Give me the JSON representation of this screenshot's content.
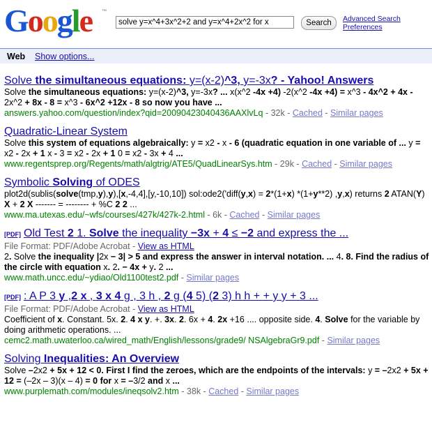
{
  "logo": {
    "letters": [
      "G",
      "o",
      "o",
      "g",
      "l",
      "e"
    ],
    "tm": "™"
  },
  "search": {
    "query": "solve y=x^4+3x^2+2 and y=x^4+2x^2 for x",
    "button": "Search",
    "advanced": "Advanced Search",
    "preferences": "Preferences"
  },
  "bar": {
    "web": "Web",
    "options": "Show options..."
  },
  "results": [
    {
      "title": [
        "Solve",
        " the simultaneous equations: ",
        "y=(x-2)",
        "^3, ",
        "y=-3x",
        "? - Yahoo! Answers"
      ],
      "snippet": [
        "Solve",
        " the simultaneous equations: ",
        "y=(x-2)",
        "^3, ",
        "y=-3x",
        "? ... ",
        "x(x^2",
        " -4x +4) ",
        "-2(x^2",
        " -4x +4) = ",
        "x^3",
        " - 4x^2 + 4x - ",
        "2x^2",
        " + 8x - 8 = ",
        "x^3",
        " - 6x^2 +12x - 8 so now you have ..."
      ],
      "url": "answers.yahoo.com/question/index?qid=20090423040436AAXlvLq",
      "size": " - 32k - ",
      "cached": "Cached",
      "similar": "Similar pages"
    },
    {
      "title": "Quadratic-Linear System",
      "snippet": [
        "Solve",
        " this system of equations algebraically: ",
        "y",
        " = ",
        "x2",
        " - ",
        "x",
        " - 6 (quadratic equation in one variable of ... ",
        "y",
        " = ",
        "x2",
        " - ",
        "2x",
        " + 1 ",
        "x",
        " - ",
        "3",
        " = ",
        "x2",
        " - ",
        "2x",
        " + 1 ",
        "0",
        " = ",
        "x2",
        " - ",
        "3x",
        " + ",
        "4",
        " ..."
      ],
      "url": "www.regentsprep.org/Regents/math/algtrig/ATE5/QuadLinearSys.htm",
      "size": " - 29k - ",
      "cached": "Cached",
      "similar": "Similar pages"
    },
    {
      "title": [
        "Symbolic ",
        "Solving",
        " of ODES"
      ],
      "snippet": [
        "plot2d(sublis(",
        "solve",
        "(tmp,",
        "y",
        "),",
        "y",
        "),[",
        "x",
        ",-4,4],[y,-10,10]) sol:ode2('diff(",
        "y",
        ",",
        "x",
        ") = ",
        "2",
        "*(1+",
        "x",
        ") *(1+",
        "y",
        "**2) ,",
        "y",
        ",",
        "x",
        ") returns ",
        "2",
        " ATAN(",
        "Y",
        ") ",
        "X",
        " + ",
        "2",
        " ",
        "X",
        " ------- = -------- + %C ",
        "2",
        " ",
        "2",
        " ..."
      ],
      "url": "www.ma.utexas.edu/~wfs/courses/427k/427k-2.html",
      "size": " - 6k - ",
      "cached": "Cached",
      "similar": "Similar pages"
    },
    {
      "pdf": "[PDF]",
      "title": [
        "Old Test ",
        "2",
        " 1. ",
        "Solve",
        " the inequality ",
        "−3x",
        " + ",
        "4",
        " ≤ ",
        "−2",
        " and express the ..."
      ],
      "format": "File Format: PDF/Adobe Acrobat - ",
      "view_html": "View as HTML",
      "snippet": [
        "2",
        ". ",
        "Solve",
        " the inequality |",
        "2x",
        " − 3| > 5 and express the answer in interval notation. ... ",
        "4",
        ". 8. Find the radius of the circle with equation ",
        "x",
        ". ",
        "2",
        ". − 4x + ",
        "y",
        ". ",
        "2",
        " ..."
      ],
      "url": "www.math.uncc.edu/~ydiao/Old1100test2.pdf",
      "size": " - ",
      "similar": "Similar pages"
    },
    {
      "pdf": "[PDF]",
      "title": [
        ": A P 3 ",
        "y",
        " ,",
        "2 x",
        " , ",
        "3 x 4",
        " g , 3 h , ",
        "2",
        " g (",
        "4",
        " 5) (",
        "2",
        " 3) h h + + y y + 3 ..."
      ],
      "format": "File Format: PDF/Adobe Acrobat - ",
      "view_html": "View as HTML",
      "snippet": [
        "Coefficient of ",
        "x",
        ". Constant. 5x. ",
        "2",
        ". ",
        "4",
        " ",
        "x",
        " ",
        "y",
        ". +. ",
        "3x",
        ". ",
        "2",
        ". 6x + ",
        "4",
        ". ",
        "2x",
        " +16 .... opposite side. ",
        "4",
        ". ",
        "Solve",
        " for the variable by doing arithmetic operations. ..."
      ],
      "url": "cemc2.math.uwaterloo.ca/wired_math/English/lessons/grade9/ NSAlgebraGr9.pdf",
      "size": " - ",
      "similar": "Similar pages"
    },
    {
      "title": [
        "Solving",
        " Inequalities: An Overview"
      ],
      "snippet": [
        "Solve",
        " –",
        "2x2",
        " + 5x + 12 < 0. First I find the zeroes, which are the endpoints of the intervals: ",
        "y",
        " = –",
        "2x2",
        " + 5x + 12 = ",
        "(–2x – 3)(x – 4)",
        " = 0 for ",
        "x",
        " = –",
        "3/2",
        " and ",
        "x",
        " ..."
      ],
      "url": "www.purplemath.com/modules/ineqsolv2.htm",
      "size": " - 38k - ",
      "cached": "Cached",
      "similar": "Similar pages"
    }
  ]
}
